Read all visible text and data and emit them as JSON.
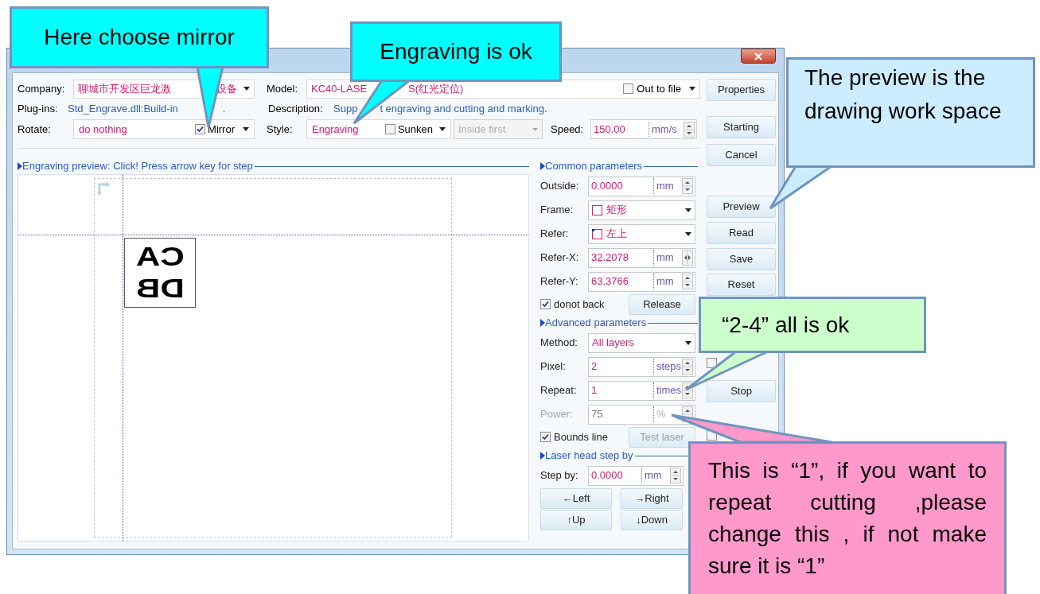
{
  "dialog": {
    "company": {
      "label": "Company:",
      "parts": [
        "聊城市开发区巨龙激",
        "设备"
      ]
    },
    "model": {
      "label": "Model:",
      "parts": [
        "KC40-LASE",
        "S(红光定位)"
      ]
    },
    "out_to_file": {
      "label": "Out to file",
      "checked": false
    },
    "plugins": {
      "label": "Plug-ins:",
      "parts": [
        "Std_Engrave.dll:Build-in",
        "."
      ]
    },
    "description": {
      "label": "Description:",
      "parts": [
        "Supp",
        "t engraving and cutting and marking."
      ]
    },
    "rotate": {
      "label": "Rotate:",
      "value": "do nothing"
    },
    "mirror": {
      "label": "Mirror",
      "checked": true
    },
    "style": {
      "label": "Style:",
      "value": "Engraving"
    },
    "sunken": {
      "label": "Sunken",
      "checked": false
    },
    "order": {
      "value": "Inside first",
      "disabled": true
    },
    "speed": {
      "label": "Speed:",
      "value": "150.00",
      "unit": "mm/s"
    },
    "preview": {
      "title": "Engraving preview: Click! Press arrow key for step",
      "artwork": [
        "CA",
        "DB"
      ]
    },
    "sections": [
      {
        "title": "Common parameters",
        "rows": [
          {
            "kind": "spin",
            "label": "Outside:",
            "value": "0.0000",
            "unit": "mm",
            "disabled": false
          },
          {
            "kind": "select",
            "label": "Frame:",
            "value": "矩形"
          },
          {
            "kind": "select",
            "label": "Refer:",
            "value": "左上"
          },
          {
            "kind": "spin",
            "label": "Refer-X:",
            "value": "32.2078",
            "unit": "mm",
            "disabled": false
          },
          {
            "kind": "spin",
            "label": "Refer-Y:",
            "value": "63.3766",
            "unit": "mm",
            "disabled": false
          },
          {
            "kind": "check",
            "label": "donot back",
            "checked": true,
            "button": "Release",
            "button_disabled": false
          }
        ]
      },
      {
        "title": "Advanced parameters",
        "rows": [
          {
            "kind": "select",
            "label": "Method:",
            "value": "All layers"
          },
          {
            "kind": "spin",
            "label": "Pixel:",
            "value": "2",
            "unit": "steps",
            "disabled": false
          },
          {
            "kind": "spin",
            "label": "Repeat:",
            "value": "1",
            "unit": "times",
            "disabled": false
          },
          {
            "kind": "spin",
            "label": "Power:",
            "value": "75",
            "unit": "%",
            "disabled": true
          },
          {
            "kind": "check",
            "label": "Bounds line",
            "checked": true,
            "button": "Test laser",
            "button_disabled": true
          }
        ]
      },
      {
        "title": "Laser head step by",
        "rows": [
          {
            "kind": "spin",
            "label": "Step by:",
            "value": "0.0000",
            "unit": "mm",
            "disabled": false
          },
          {
            "kind": "buttons",
            "buttons": [
              "←Left",
              "→Right"
            ]
          },
          {
            "kind": "buttons",
            "buttons": [
              "↑Up",
              "↓Down"
            ]
          }
        ]
      }
    ],
    "side": [
      {
        "kind": "button",
        "label": "Properties"
      },
      {
        "kind": "button",
        "label": "Starting"
      },
      {
        "kind": "button",
        "label": "Cancel"
      },
      {
        "kind": "button",
        "label": "Preview"
      },
      {
        "kind": "button",
        "label": "Read"
      },
      {
        "kind": "button",
        "label": "Save"
      },
      {
        "kind": "button",
        "label": "Reset"
      },
      {
        "kind": "checkbox",
        "checked": false
      },
      {
        "kind": "button",
        "label": "Stop"
      },
      {
        "kind": "checkbox",
        "checked": false
      }
    ]
  },
  "callouts": [
    {
      "text": "Here choose mirror",
      "color": "#00ffff"
    },
    {
      "text": "Engraving is ok",
      "color": "#00ffff"
    },
    {
      "text": "The preview is the drawing work space",
      "color": "#ccecff"
    },
    {
      "text": "“2-4” all is ok",
      "color": "#ccffcc"
    },
    {
      "text": "This is “1”, if you want to repeat cutting ,please change this , if not make sure it is “1”",
      "color": "#ff99cc"
    }
  ]
}
